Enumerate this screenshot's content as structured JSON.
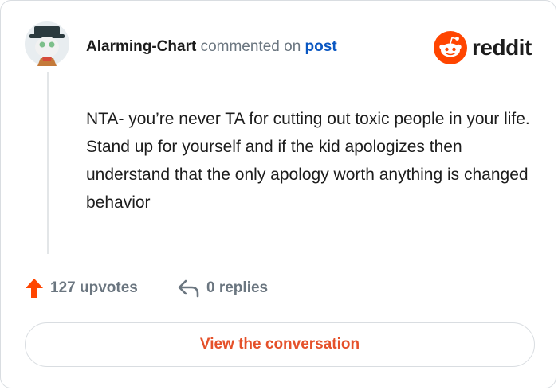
{
  "comment_card": {
    "username": "Alarming-Chart",
    "action_text": "commented on",
    "post_link": "post",
    "brand": "reddit",
    "brand_color": "#ff4500",
    "body": "NTA- you’re never TA for cutting out toxic people in your life. Stand up for yourself and if the kid apologizes then understand that the only apology worth anything is changed behavior",
    "upvotes": "127 upvotes",
    "replies": "0 replies",
    "view_button": "View the conversation",
    "icons": {
      "avatar": "snoo-avatar-with-hat",
      "upvote": "arrow-up-icon",
      "reply": "reply-arrow-icon",
      "logo": "reddit-snoo-icon"
    }
  }
}
